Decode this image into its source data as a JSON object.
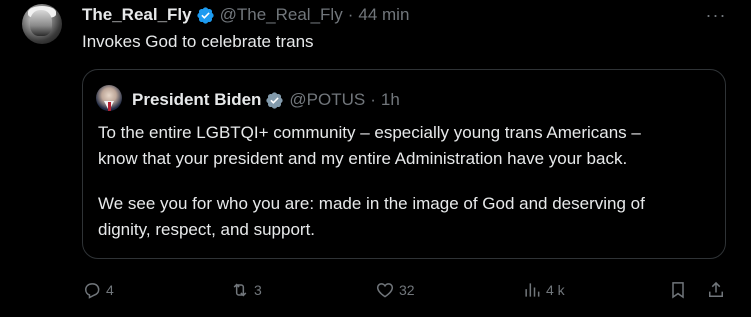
{
  "tweet": {
    "author_name": "The_Real_Fly",
    "author_handle": "@The_Real_Fly",
    "separator": "·",
    "time": "44 min",
    "text": "Invokes God to celebrate trans",
    "more_label": "···"
  },
  "quote": {
    "author_name": "President Biden",
    "author_handle": "@POTUS",
    "separator": "·",
    "time": "1h",
    "paragraphs": [
      "To the entire LGBTQI+ community – especially young trans Americans –",
      "know that your president and my entire Administration have your back.",
      "We see you for who you are: made in the image of God and deserving of",
      "dignity, respect, and support."
    ]
  },
  "actions": {
    "reply_count": "4",
    "repost_count": "3",
    "like_count": "32",
    "views_count": "4 k"
  },
  "colors": {
    "background": "#000000",
    "text": "#e7e9ea",
    "secondary": "#71767b",
    "border": "#2f3336",
    "verified_blue": "#1d9bf0",
    "verified_gray": "#829aab"
  }
}
